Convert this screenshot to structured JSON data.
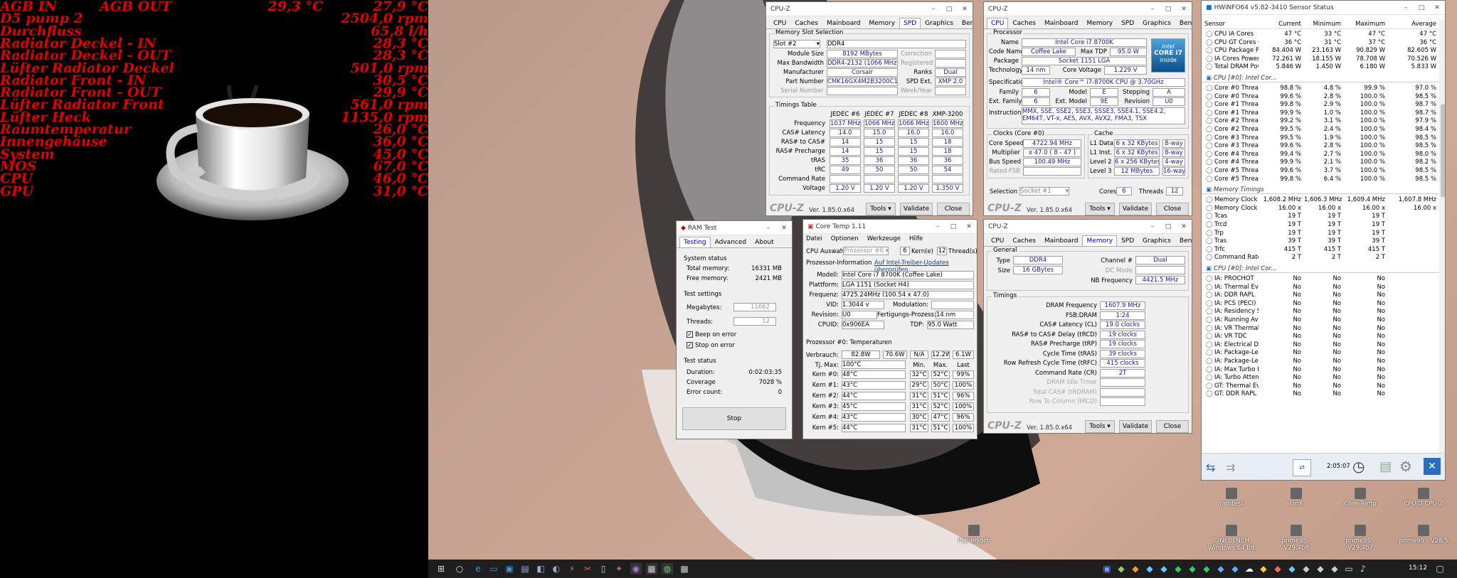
{
  "monitor": {
    "rows": [
      {
        "label": "AGB IN",
        "label2": "AGB OUT",
        "v1": "29,3 °C",
        "v2": "27,9 °C"
      },
      {
        "label": "D5 pump 2",
        "v2": "2504,0 rpm"
      },
      {
        "label": "Durchfluss",
        "v2": "65,8 l/h"
      },
      {
        "label": "Radiator Deckel - IN",
        "v2": "28,3 °C"
      },
      {
        "label": "Radiator Deckel - OUT",
        "v2": "28,3 °C"
      },
      {
        "label": "Lüfter Radiator Deckel",
        "v2": "501,0 rpm"
      },
      {
        "label": "Radiator Front - IN",
        "v2": "30,5 °C"
      },
      {
        "label": "Radiator Front - OUT",
        "v2": "29,9 °C"
      },
      {
        "label": "Lüfter Radiator Front",
        "v2": "561,0 rpm"
      },
      {
        "label": "Lüfter Heck",
        "v2": "1135,0 rpm"
      },
      {
        "label": "Raumtemperatur",
        "v2": "26,0 °C"
      },
      {
        "label": "Innengehäuse",
        "v2": "36,0 °C"
      },
      {
        "label": "System",
        "v2": "45,0 °C"
      },
      {
        "label": "MOS",
        "v2": "67,0 °C"
      },
      {
        "label": "CPU",
        "v2": "46,0 °C"
      },
      {
        "label": "GPU",
        "v2": "31,0 °C"
      }
    ]
  },
  "cpuz_common": {
    "title": "CPU-Z",
    "version": "Ver. 1.85.0.x64",
    "tools": "Tools",
    "validate": "Validate",
    "close": "Close",
    "brand": "CPU-Z",
    "tabs": [
      "CPU",
      "Caches",
      "Mainboard",
      "Memory",
      "SPD",
      "Graphics",
      "Bench",
      "About"
    ]
  },
  "spd": {
    "slot_group": "Memory Slot Selection",
    "slot": "Slot #2",
    "type": "DDR4",
    "labels": [
      "Module Size",
      "Max Bandwidth",
      "Manufacturer",
      "Part Number",
      "Serial Number"
    ],
    "values": [
      "8192 MBytes",
      "DDR4-2132 (1066 MHz)",
      "Corsair",
      "CMK16GX4M2B3200C16",
      ""
    ],
    "right_labels": [
      "Correction",
      "Registered",
      "Ranks",
      "SPD Ext.",
      "Week/Year"
    ],
    "right_values": [
      "",
      "",
      "Dual",
      "XMP 2.0",
      ""
    ],
    "timings_group": "Timings Table",
    "cols": [
      "JEDEC #6",
      "JEDEC #7",
      "JEDEC #8",
      "XMP-3200"
    ],
    "rows": [
      {
        "l": "Frequency",
        "v": [
          "1037 MHz",
          "1066 MHz",
          "1066 MHz",
          "1600 MHz"
        ]
      },
      {
        "l": "CAS# Latency",
        "v": [
          "14.0",
          "15.0",
          "16.0",
          "16.0"
        ]
      },
      {
        "l": "RAS# to CAS#",
        "v": [
          "14",
          "15",
          "15",
          "18"
        ]
      },
      {
        "l": "RAS# Precharge",
        "v": [
          "14",
          "15",
          "15",
          "18"
        ]
      },
      {
        "l": "tRAS",
        "v": [
          "35",
          "36",
          "36",
          "36"
        ]
      },
      {
        "l": "tRC",
        "v": [
          "49",
          "50",
          "50",
          "54"
        ]
      },
      {
        "l": "Command Rate",
        "v": [
          "",
          "",
          "",
          ""
        ]
      },
      {
        "l": "Voltage",
        "v": [
          "1.20 V",
          "1.20 V",
          "1.20 V",
          "1.350 V"
        ]
      }
    ]
  },
  "cpu": {
    "proc_group": "Processor",
    "name_l": "Name",
    "name": "Intel Core i7 8700K",
    "code_l": "Code Name",
    "code": "Coffee Lake",
    "tdp_l": "Max TDP",
    "tdp": "95.0 W",
    "pkg_l": "Package",
    "pkg": "Socket 1151 LGA",
    "tech_l": "Technology",
    "tech": "14 nm",
    "cv_l": "Core Voltage",
    "cv": "1.229 V",
    "spec_l": "Specification",
    "spec": "Intel® Core™ i7-8700K CPU @ 3.70GHz",
    "fam_l": "Family",
    "fam": "6",
    "mod_l": "Model",
    "mod": "E",
    "step_l": "Stepping",
    "step": "A",
    "efam_l": "Ext. Family",
    "efam": "6",
    "emod_l": "Ext. Model",
    "emod": "9E",
    "rev_l": "Revision",
    "rev": "U0",
    "inst_l": "Instructions",
    "inst": "MMX, SSE, SSE2, SSE3, SSSE3, SSE4.1, SSE4.2, EM64T, VT-x, AES, AVX, AVX2, FMA3, TSX",
    "clocks_group": "Clocks (Core #0)",
    "cs_l": "Core Speed",
    "cs": "4722.94 MHz",
    "mul_l": "Multiplier",
    "mul": "x 47.0 ( 8 - 47 )",
    "bus_l": "Bus Speed",
    "bus": "100.49 MHz",
    "fsb_l": "Rated FSB",
    "fsb": "",
    "cache_group": "Cache",
    "cache": [
      {
        "l": "L1 Data",
        "v": "6 x 32 KBytes",
        "w": "8-way"
      },
      {
        "l": "L1 Inst.",
        "v": "6 x 32 KBytes",
        "w": "8-way"
      },
      {
        "l": "Level 2",
        "v": "6 x 256 KBytes",
        "w": "4-way"
      },
      {
        "l": "Level 3",
        "v": "12 MBytes",
        "w": "16-way"
      }
    ],
    "sel_l": "Selection",
    "sel": "Socket #1",
    "cores_l": "Cores",
    "cores": "6",
    "threads_l": "Threads",
    "threads": "12",
    "logo_l1": "CORE i7",
    "logo_l2": "intel",
    "logo_l3": "inside"
  },
  "mem": {
    "gen_group": "General",
    "type_l": "Type",
    "type": "DDR4",
    "size_l": "Size",
    "size": "16 GBytes",
    "ch_l": "Channel #",
    "ch": "Dual",
    "dc_l": "DC Mode",
    "dc": "",
    "nb_l": "NB Frequency",
    "nb": "4421.5 MHz",
    "tim_group": "Timings",
    "rows": [
      {
        "l": "DRAM Frequency",
        "v": "1607.9 MHz"
      },
      {
        "l": "FSB:DRAM",
        "v": "1:24"
      },
      {
        "l": "CAS# Latency (CL)",
        "v": "19.0 clocks"
      },
      {
        "l": "RAS# to CAS# Delay (tRCD)",
        "v": "19 clocks"
      },
      {
        "l": "RAS# Precharge (tRP)",
        "v": "19 clocks"
      },
      {
        "l": "Cycle Time (tRAS)",
        "v": "39 clocks"
      },
      {
        "l": "Row Refresh Cycle Time (tRFC)",
        "v": "415 clocks"
      },
      {
        "l": "Command Rate (CR)",
        "v": "2T"
      },
      {
        "l": "DRAM Idle Timer",
        "v": ""
      },
      {
        "l": "Total CAS# (tRDRAM)",
        "v": ""
      },
      {
        "l": "Row To Column (tRCD)",
        "v": ""
      }
    ]
  },
  "ramtest": {
    "title": "RAM Test",
    "tabs": [
      "Testing",
      "Advanced",
      "About"
    ],
    "status_group": "System status",
    "total_l": "Total memory:",
    "total": "16331 MB",
    "free_l": "Free memory:",
    "free": "2421 MB",
    "settings_group": "Test settings",
    "mb_l": "Megabytes:",
    "mb": "11662",
    "thr_l": "Threads:",
    "thr": "12",
    "beep": "Beep on error",
    "stop_err": "Stop on error",
    "tstatus_group": "Test status",
    "dur_l": "Duration:",
    "dur": "0:02:03:35",
    "cov_l": "Coverage",
    "cov": "7028 %",
    "err_l": "Error count:",
    "err": "0",
    "stop": "Stop"
  },
  "coretemp": {
    "title": "Core Temp 1.11",
    "menu": [
      "Datei",
      "Optionen",
      "Werkzeuge",
      "Hilfe"
    ],
    "sel_l": "CPU Auswahl:",
    "sel": "Prozessor #0",
    "kern": "6",
    "kern_l": "Kern(e)",
    "thr": "12",
    "thr_l": "Thread(s)",
    "info_l": "Prozessor-Information",
    "link": "Auf Intel-Treiber-Updates überprüfen",
    "model_l": "Modell:",
    "model": "Intel Core i7 8700K (Coffee Lake)",
    "plat_l": "Plattform:",
    "plat": "LGA 1151 (Socket H4)",
    "freq_l": "Frequenz:",
    "freq": "4725.24MHz (100.54 x 47.0)",
    "vid_l": "VID:",
    "vid": "1.3044 v",
    "modu_l": "Modulation:",
    "modu": "",
    "rev_l": "Revision:",
    "rev": "U0",
    "fert_l": "Fertigungs-Prozess:",
    "fert": "14 nm",
    "cpuid_l": "CPUID:",
    "cpuid": "0x906EA",
    "tdp_l": "TDP:",
    "tdp": "95.0 Watt",
    "temp_head": "Prozessor #0: Temperaturen",
    "verb_l": "Verbrauch:",
    "verb": [
      "82.8W",
      "70.6W",
      "N/A",
      "12.2W",
      "6.1W"
    ],
    "tj_l": "Tj. Max:",
    "tj": "100°C",
    "min_h": "Min.",
    "max_h": "Max.",
    "last_h": "Last",
    "cores": [
      {
        "l": "Kern #0:",
        "t": "48°C",
        "mn": "32°C",
        "mx": "52°C",
        "ld": "99%"
      },
      {
        "l": "Kern #1:",
        "t": "43°C",
        "mn": "29°C",
        "mx": "50°C",
        "ld": "100%"
      },
      {
        "l": "Kern #2:",
        "t": "44°C",
        "mn": "31°C",
        "mx": "51°C",
        "ld": "96%"
      },
      {
        "l": "Kern #3:",
        "t": "45°C",
        "mn": "31°C",
        "mx": "52°C",
        "ld": "100%"
      },
      {
        "l": "Kern #4:",
        "t": "43°C",
        "mn": "30°C",
        "mx": "47°C",
        "ld": "96%"
      },
      {
        "l": "Kern #5:",
        "t": "44°C",
        "mn": "31°C",
        "mx": "51°C",
        "ld": "100%"
      }
    ]
  },
  "hwinfo": {
    "title": "HWiNFO64 v5.82-3410 Sensor Status",
    "cols": [
      "Sensor",
      "Current",
      "Minimum",
      "Maximum",
      "Average"
    ],
    "rows": [
      {
        "t": "r",
        "n": "CPU IA Cores",
        "v": [
          "47 °C",
          "33 °C",
          "47 °C",
          "47 °C"
        ]
      },
      {
        "t": "r",
        "n": "CPU GT Cores (Gra...",
        "v": [
          "36 °C",
          "31 °C",
          "37 °C",
          "36 °C"
        ]
      },
      {
        "t": "r",
        "n": "CPU Package Power",
        "v": [
          "84.404 W",
          "23.163 W",
          "90.829 W",
          "82.605 W"
        ]
      },
      {
        "t": "r",
        "n": "IA Cores Power",
        "v": [
          "72.261 W",
          "18.155 W",
          "78.708 W",
          "70.526 W"
        ]
      },
      {
        "t": "r",
        "n": "Total DRAM Power",
        "v": [
          "5.846 W",
          "1.450 W",
          "6.180 W",
          "5.833 W"
        ]
      },
      {
        "t": "s",
        "n": "CPU [#0]: Intel Cor..."
      },
      {
        "t": "r",
        "n": "Core #0 Thread 0 ...",
        "v": [
          "98.8 %",
          "4.8 %",
          "99.9 %",
          "97.0 %"
        ]
      },
      {
        "t": "r",
        "n": "Core #0 Thread 1 ...",
        "v": [
          "99.6 %",
          "2.8 %",
          "100.0 %",
          "98.5 %"
        ]
      },
      {
        "t": "r",
        "n": "Core #1 Thread 0 ...",
        "v": [
          "99.8 %",
          "2.9 %",
          "100.0 %",
          "98.7 %"
        ]
      },
      {
        "t": "r",
        "n": "Core #1 Thread 1 ...",
        "v": [
          "99.9 %",
          "1.0 %",
          "100.0 %",
          "98.7 %"
        ]
      },
      {
        "t": "r",
        "n": "Core #2 Thread 0 ...",
        "v": [
          "99.2 %",
          "3.1 %",
          "100.0 %",
          "97.9 %"
        ]
      },
      {
        "t": "r",
        "n": "Core #2 Thread 1 ...",
        "v": [
          "99.5 %",
          "2.4 %",
          "100.0 %",
          "98.4 %"
        ]
      },
      {
        "t": "r",
        "n": "Core #3 Thread 0 ...",
        "v": [
          "99.5 %",
          "1.9 %",
          "100.0 %",
          "98.5 %"
        ]
      },
      {
        "t": "r",
        "n": "Core #3 Thread 1 ...",
        "v": [
          "99.6 %",
          "2.8 %",
          "100.0 %",
          "98.5 %"
        ]
      },
      {
        "t": "r",
        "n": "Core #4 Thread 0 ...",
        "v": [
          "99.4 %",
          "2.7 %",
          "100.0 %",
          "98.0 %"
        ]
      },
      {
        "t": "r",
        "n": "Core #4 Thread 1 ...",
        "v": [
          "99.9 %",
          "2.1 %",
          "100.0 %",
          "98.2 %"
        ]
      },
      {
        "t": "r",
        "n": "Core #5 Thread 0 ...",
        "v": [
          "99.6 %",
          "3.7 %",
          "100.0 %",
          "98.5 %"
        ]
      },
      {
        "t": "r",
        "n": "Core #5 Thread 1 ...",
        "v": [
          "99.8 %",
          "6.4 %",
          "100.0 %",
          "98.5 %"
        ]
      },
      {
        "t": "s",
        "n": "Memory Timings"
      },
      {
        "t": "r",
        "n": "Memory Clock",
        "v": [
          "1,608.2 MHz",
          "1,606.3 MHz",
          "1,609.4 MHz",
          "1,607.8 MHz"
        ]
      },
      {
        "t": "r",
        "n": "Memory Clock Ratio",
        "v": [
          "16.00 x",
          "16.00 x",
          "16.00 x",
          "16.00 x"
        ]
      },
      {
        "t": "r",
        "n": "Tcas",
        "v": [
          "19 T",
          "19 T",
          "19 T",
          ""
        ]
      },
      {
        "t": "r",
        "n": "Trcd",
        "v": [
          "19 T",
          "19 T",
          "19 T",
          ""
        ]
      },
      {
        "t": "r",
        "n": "Trp",
        "v": [
          "19 T",
          "19 T",
          "19 T",
          ""
        ]
      },
      {
        "t": "r",
        "n": "Tras",
        "v": [
          "39 T",
          "39 T",
          "39 T",
          ""
        ]
      },
      {
        "t": "r",
        "n": "Trfc",
        "v": [
          "415 T",
          "415 T",
          "415 T",
          ""
        ]
      },
      {
        "t": "r",
        "n": "Command Rate",
        "v": [
          "2 T",
          "2 T",
          "2 T",
          ""
        ]
      },
      {
        "t": "s",
        "n": "CPU [#0]: Intel Cor..."
      },
      {
        "t": "r",
        "n": "IA: PROCHOT",
        "v": [
          "No",
          "No",
          "No",
          ""
        ]
      },
      {
        "t": "r",
        "n": "IA: Thermal Event",
        "v": [
          "No",
          "No",
          "No",
          ""
        ]
      },
      {
        "t": "r",
        "n": "IA: DDR RAPL",
        "v": [
          "No",
          "No",
          "No",
          ""
        ]
      },
      {
        "t": "r",
        "n": "IA: PCS (PECI)",
        "v": [
          "No",
          "No",
          "No",
          ""
        ]
      },
      {
        "t": "r",
        "n": "IA: Residency Stat...",
        "v": [
          "No",
          "No",
          "No",
          ""
        ]
      },
      {
        "t": "r",
        "n": "IA: Running Averag...",
        "v": [
          "No",
          "No",
          "No",
          ""
        ]
      },
      {
        "t": "r",
        "n": "IA: VR Thermal Alert",
        "v": [
          "No",
          "No",
          "No",
          ""
        ]
      },
      {
        "t": "r",
        "n": "IA: VR TDC",
        "v": [
          "No",
          "No",
          "No",
          ""
        ]
      },
      {
        "t": "r",
        "n": "IA: Electrical Design...",
        "v": [
          "No",
          "No",
          "No",
          ""
        ]
      },
      {
        "t": "r",
        "n": "IA: Package-Level ...",
        "v": [
          "No",
          "No",
          "No",
          ""
        ]
      },
      {
        "t": "r",
        "n": "IA: Package-Level ...",
        "v": [
          "No",
          "No",
          "No",
          ""
        ]
      },
      {
        "t": "r",
        "n": "IA: Max Turbo Limit",
        "v": [
          "No",
          "No",
          "No",
          ""
        ]
      },
      {
        "t": "r",
        "n": "IA: Turbo Attenuati...",
        "v": [
          "No",
          "No",
          "No",
          ""
        ]
      },
      {
        "t": "r",
        "n": "GT: Thermal Event",
        "v": [
          "No",
          "No",
          "No",
          ""
        ]
      },
      {
        "t": "r",
        "n": "GT: DDR RAPL",
        "v": [
          "No",
          "No",
          "No",
          ""
        ]
      }
    ],
    "time": "2:05:07"
  },
  "desktop": {
    "icons": [
      "ramtest",
      "LinX",
      "Core Temp",
      "CPUID CPU-Z",
      "CINEBENCH Windows 64 Bit",
      "prime95 - V29.4b8",
      "prime95 - V29.4b7",
      "prime95 - V28.5",
      "Papierkorb"
    ]
  },
  "taskbar": {
    "clock": "15:12"
  },
  "colors": {
    "monitor_red": "#e00000",
    "cpuz_value": "#1a1a9a",
    "hwinfo_blue": "#0078d7"
  }
}
